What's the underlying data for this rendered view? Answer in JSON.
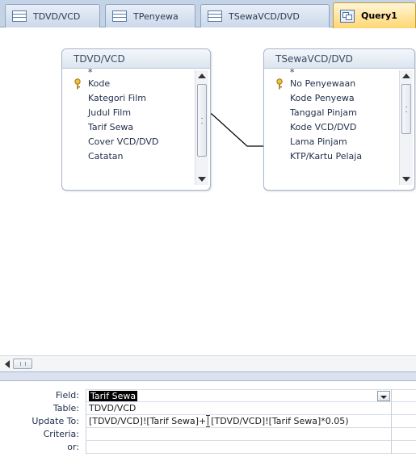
{
  "tabs": [
    {
      "label": "TDVD/VCD",
      "active": false,
      "icon": "table-icon"
    },
    {
      "label": "TPenyewa",
      "active": false,
      "icon": "table-icon"
    },
    {
      "label": "TSewaVCD/DVD",
      "active": false,
      "icon": "table-icon"
    },
    {
      "label": "Query1",
      "active": true,
      "icon": "query-icon"
    }
  ],
  "tables": [
    {
      "title": "TDVD/VCD",
      "fields": [
        {
          "label": "*",
          "key": false
        },
        {
          "label": "Kode",
          "key": true
        },
        {
          "label": "Kategori Film",
          "key": false
        },
        {
          "label": "Judul Film",
          "key": false
        },
        {
          "label": "Tarif Sewa",
          "key": false
        },
        {
          "label": "Cover VCD/DVD",
          "key": false
        },
        {
          "label": "Catatan",
          "key": false
        }
      ]
    },
    {
      "title": "TSewaVCD/DVD",
      "fields": [
        {
          "label": "*",
          "key": false
        },
        {
          "label": "No Penyewaan",
          "key": true
        },
        {
          "label": "Kode Penyewa",
          "key": false
        },
        {
          "label": "Tanggal Pinjam",
          "key": false
        },
        {
          "label": "Kode VCD/DVD",
          "key": false
        },
        {
          "label": "Lama Pinjam",
          "key": false
        },
        {
          "label": "KTP/Kartu Pelaja",
          "key": false
        }
      ]
    }
  ],
  "grid": {
    "row_labels": {
      "field": "Field:",
      "table": "Table:",
      "update_to": "Update To:",
      "criteria": "Criteria:",
      "or": "or:"
    },
    "field_value": "Tarif Sewa",
    "table_value": "TDVD/VCD",
    "update_to_before": "[TDVD/VCD]![Tarif Sewa]+",
    "update_to_after": "[TDVD/VCD]![Tarif Sewa]*0.05)",
    "criteria_value": "",
    "or_value": ""
  },
  "colors": {
    "tab_strip": "#c5d3e6",
    "active_tab": "#ffd772",
    "relationship_line": "#000000"
  }
}
